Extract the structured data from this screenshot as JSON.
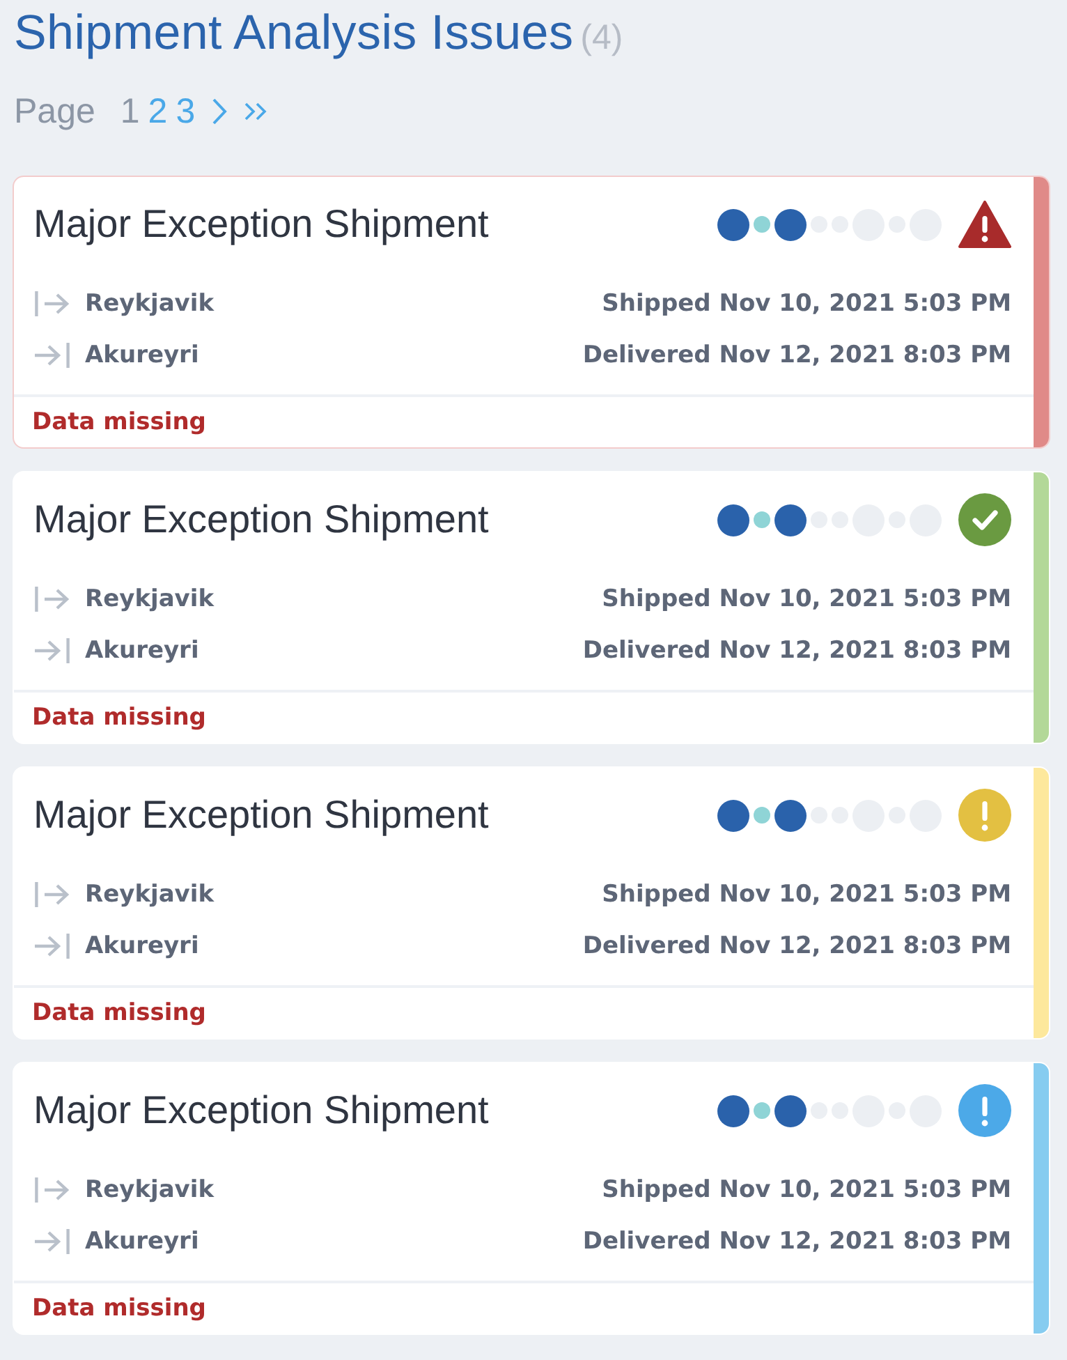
{
  "header": {
    "title": "Shipment Analysis Issues",
    "count": "(4)"
  },
  "pagination": {
    "label": "Page",
    "pages": [
      {
        "label": "1",
        "selected": true
      },
      {
        "label": "2",
        "selected": false
      },
      {
        "label": "3",
        "selected": false
      }
    ]
  },
  "cards": [
    {
      "title": "Major Exception Shipment",
      "selected": true,
      "kind": "error",
      "color": "#e08a88",
      "steps": [
        {
          "kind": "stop",
          "done": true,
          "current": false
        },
        {
          "kind": "leg",
          "done": false,
          "current": true
        },
        {
          "kind": "stop",
          "done": true,
          "current": false
        },
        {
          "kind": "leg",
          "done": false,
          "current": false
        },
        {
          "kind": "leg",
          "done": false,
          "current": false
        },
        {
          "kind": "stop",
          "done": false,
          "current": false
        },
        {
          "kind": "leg",
          "done": false,
          "current": false
        },
        {
          "kind": "stop",
          "done": false,
          "current": false
        }
      ],
      "origin": "Reykjavik",
      "shipped": "Shipped Nov 10, 2021 5:03 PM",
      "destination": "Akureyri",
      "delivered": "Delivered Nov 12, 2021 8:03 PM",
      "issue": "Data missing"
    },
    {
      "title": "Major Exception Shipment",
      "selected": false,
      "kind": "success",
      "color": "#b3d898",
      "steps": [
        {
          "kind": "stop",
          "done": true,
          "current": false
        },
        {
          "kind": "leg",
          "done": false,
          "current": true
        },
        {
          "kind": "stop",
          "done": true,
          "current": false
        },
        {
          "kind": "leg",
          "done": false,
          "current": false
        },
        {
          "kind": "leg",
          "done": false,
          "current": false
        },
        {
          "kind": "stop",
          "done": false,
          "current": false
        },
        {
          "kind": "leg",
          "done": false,
          "current": false
        },
        {
          "kind": "stop",
          "done": false,
          "current": false
        }
      ],
      "origin": "Reykjavik",
      "shipped": "Shipped Nov 10, 2021 5:03 PM",
      "destination": "Akureyri",
      "delivered": "Delivered Nov 12, 2021 8:03 PM",
      "issue": "Data missing"
    },
    {
      "title": "Major Exception Shipment",
      "selected": false,
      "kind": "warning",
      "color": "#fde89c",
      "steps": [
        {
          "kind": "stop",
          "done": true,
          "current": false
        },
        {
          "kind": "leg",
          "done": false,
          "current": true
        },
        {
          "kind": "stop",
          "done": true,
          "current": false
        },
        {
          "kind": "leg",
          "done": false,
          "current": false
        },
        {
          "kind": "leg",
          "done": false,
          "current": false
        },
        {
          "kind": "stop",
          "done": false,
          "current": false
        },
        {
          "kind": "leg",
          "done": false,
          "current": false
        },
        {
          "kind": "stop",
          "done": false,
          "current": false
        }
      ],
      "origin": "Reykjavik",
      "shipped": "Shipped Nov 10, 2021 5:03 PM",
      "destination": "Akureyri",
      "delivered": "Delivered Nov 12, 2021 8:03 PM",
      "issue": "Data missing"
    },
    {
      "title": "Major Exception Shipment",
      "selected": false,
      "kind": "info",
      "color": "#86ccf0",
      "steps": [
        {
          "kind": "stop",
          "done": true,
          "current": false
        },
        {
          "kind": "leg",
          "done": false,
          "current": true
        },
        {
          "kind": "stop",
          "done": true,
          "current": false
        },
        {
          "kind": "leg",
          "done": false,
          "current": false
        },
        {
          "kind": "leg",
          "done": false,
          "current": false
        },
        {
          "kind": "stop",
          "done": false,
          "current": false
        },
        {
          "kind": "leg",
          "done": false,
          "current": false
        },
        {
          "kind": "stop",
          "done": false,
          "current": false
        }
      ],
      "origin": "Reykjavik",
      "shipped": "Shipped Nov 10, 2021 5:03 PM",
      "destination": "Akureyri",
      "delivered": "Delivered Nov 12, 2021 8:03 PM",
      "issue": "Data missing"
    }
  ]
}
